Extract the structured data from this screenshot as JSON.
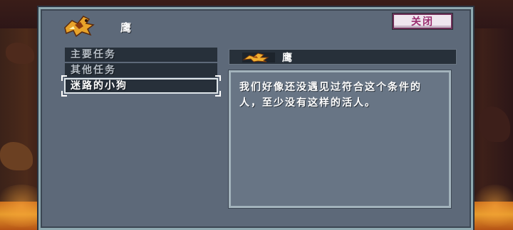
{
  "window": {
    "title": "鹰",
    "close_label": "关闭"
  },
  "quests": [
    {
      "label": "主要任务",
      "selected": false
    },
    {
      "label": "其他任务",
      "selected": false
    },
    {
      "label": "迷路的小狗",
      "selected": true
    }
  ],
  "detail": {
    "title": "鹰",
    "text": "我们好像还没遇见过符合这个条件的人，至少没有这样的活人。"
  },
  "icons": {
    "window_icon": "eagle-icon",
    "detail_icon": "eagle-icon"
  },
  "colors": {
    "panel": "#5d6979",
    "dark_row": "#27303a",
    "close_text": "#9a2c6f",
    "lava": "#e69a2c"
  }
}
